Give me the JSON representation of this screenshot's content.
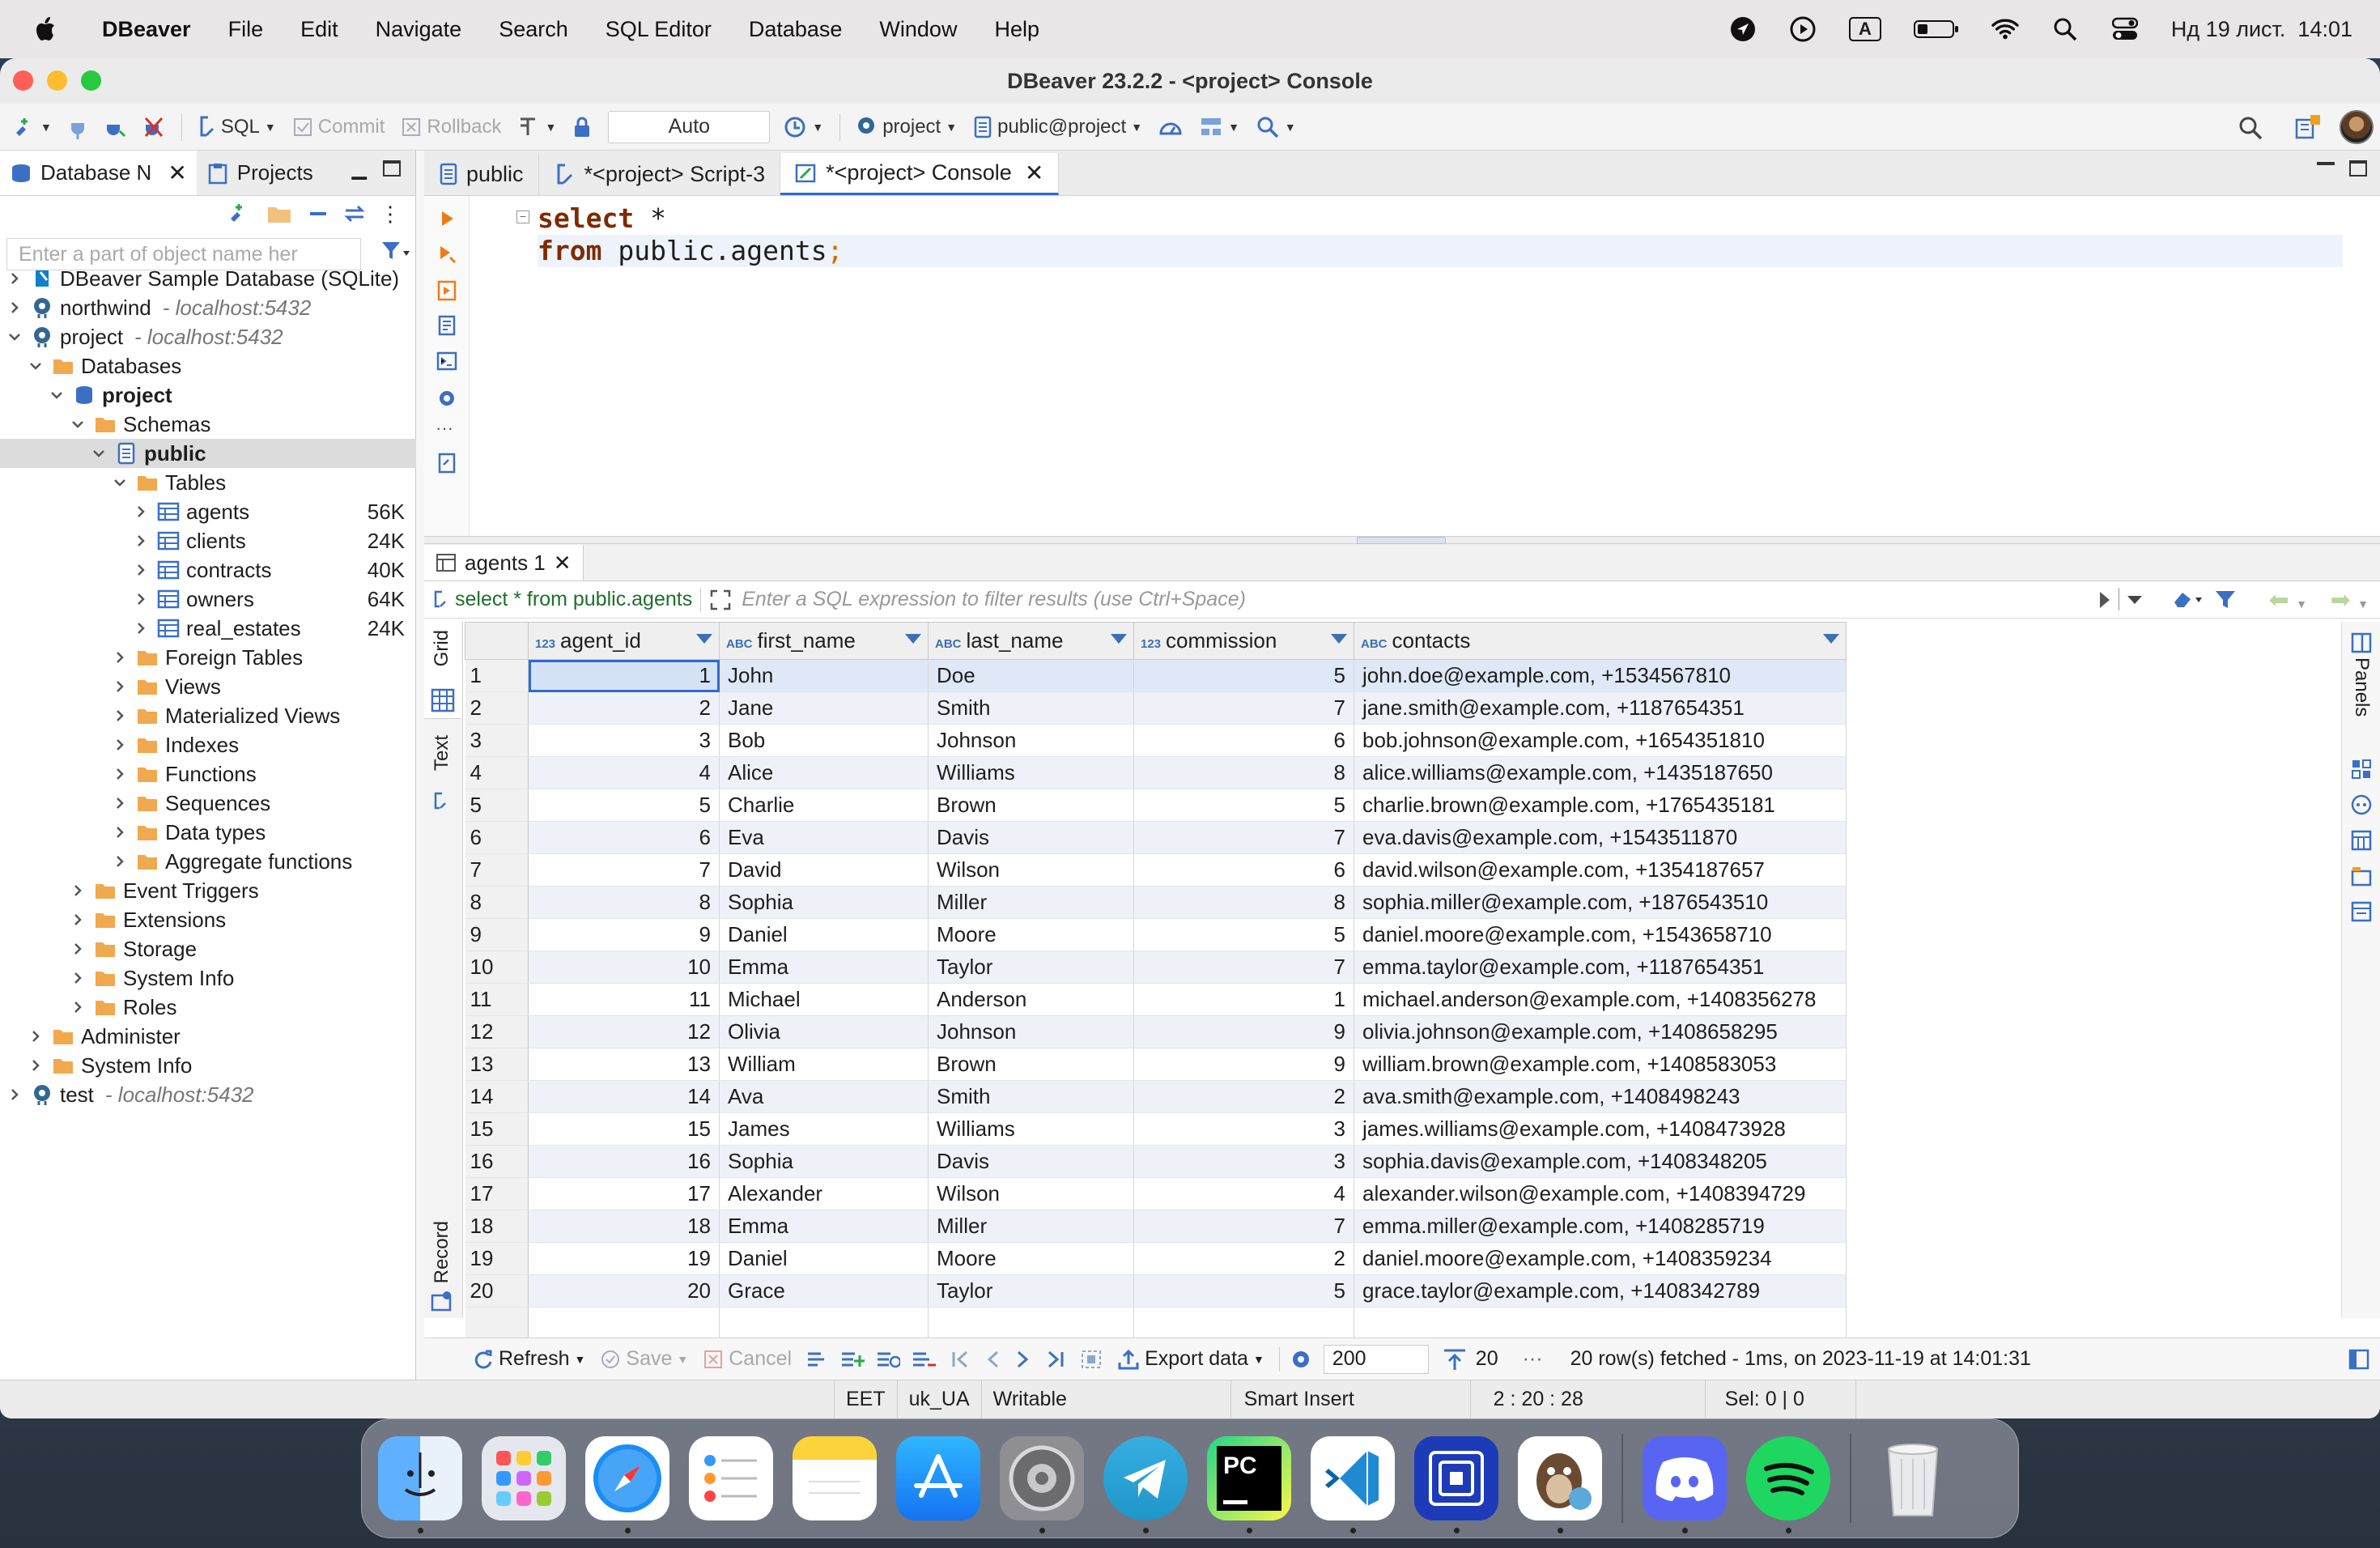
{
  "menubar": {
    "app": "DBeaver",
    "items": [
      "File",
      "Edit",
      "Navigate",
      "Search",
      "SQL Editor",
      "Database",
      "Window",
      "Help"
    ],
    "keyboard": "A",
    "datetime": "Нд 19 лист.  14:01"
  },
  "window": {
    "title": "DBeaver 23.2.2 - <project> Console"
  },
  "toolbar": {
    "sql": "SQL",
    "commit": "Commit",
    "rollback": "Rollback",
    "mode": "Auto",
    "datasource": "project",
    "schema": "public@project"
  },
  "navigator": {
    "tab_db": "Database N",
    "tab_projects": "Projects",
    "filter_placeholder": "Enter a part of object name her",
    "tree": [
      {
        "label": "DBeaver Sample Database (SQLite)",
        "host": "",
        "size": "",
        "indent": 0,
        "tw": ">",
        "icon": "sqlite"
      },
      {
        "label": "northwind",
        "host": "- localhost:5432",
        "size": "",
        "indent": 0,
        "tw": ">",
        "icon": "pg"
      },
      {
        "label": "project",
        "host": "- localhost:5432",
        "size": "",
        "indent": 0,
        "tw": "v",
        "icon": "pg"
      },
      {
        "label": "Databases",
        "host": "",
        "size": "",
        "indent": 1,
        "tw": "v",
        "icon": "folder"
      },
      {
        "label": "project",
        "host": "",
        "size": "",
        "indent": 2,
        "tw": "v",
        "icon": "db",
        "bold": true
      },
      {
        "label": "Schemas",
        "host": "",
        "size": "",
        "indent": 3,
        "tw": "v",
        "icon": "folder"
      },
      {
        "label": "public",
        "host": "",
        "size": "",
        "indent": 4,
        "tw": "v",
        "icon": "schema",
        "bold": true,
        "sel": true
      },
      {
        "label": "Tables",
        "host": "",
        "size": "",
        "indent": 5,
        "tw": "v",
        "icon": "folder"
      },
      {
        "label": "agents",
        "host": "",
        "size": "56K",
        "indent": 6,
        "tw": ">",
        "icon": "table"
      },
      {
        "label": "clients",
        "host": "",
        "size": "24K",
        "indent": 6,
        "tw": ">",
        "icon": "table"
      },
      {
        "label": "contracts",
        "host": "",
        "size": "40K",
        "indent": 6,
        "tw": ">",
        "icon": "table"
      },
      {
        "label": "owners",
        "host": "",
        "size": "64K",
        "indent": 6,
        "tw": ">",
        "icon": "table"
      },
      {
        "label": "real_estates",
        "host": "",
        "size": "24K",
        "indent": 6,
        "tw": ">",
        "icon": "table"
      },
      {
        "label": "Foreign Tables",
        "host": "",
        "size": "",
        "indent": 5,
        "tw": ">",
        "icon": "folder"
      },
      {
        "label": "Views",
        "host": "",
        "size": "",
        "indent": 5,
        "tw": ">",
        "icon": "folder"
      },
      {
        "label": "Materialized Views",
        "host": "",
        "size": "",
        "indent": 5,
        "tw": ">",
        "icon": "folder"
      },
      {
        "label": "Indexes",
        "host": "",
        "size": "",
        "indent": 5,
        "tw": ">",
        "icon": "folder"
      },
      {
        "label": "Functions",
        "host": "",
        "size": "",
        "indent": 5,
        "tw": ">",
        "icon": "folder"
      },
      {
        "label": "Sequences",
        "host": "",
        "size": "",
        "indent": 5,
        "tw": ">",
        "icon": "folder"
      },
      {
        "label": "Data types",
        "host": "",
        "size": "",
        "indent": 5,
        "tw": ">",
        "icon": "folder"
      },
      {
        "label": "Aggregate functions",
        "host": "",
        "size": "",
        "indent": 5,
        "tw": ">",
        "icon": "folder"
      },
      {
        "label": "Event Triggers",
        "host": "",
        "size": "",
        "indent": 3,
        "tw": ">",
        "icon": "folder"
      },
      {
        "label": "Extensions",
        "host": "",
        "size": "",
        "indent": 3,
        "tw": ">",
        "icon": "folder"
      },
      {
        "label": "Storage",
        "host": "",
        "size": "",
        "indent": 3,
        "tw": ">",
        "icon": "folder"
      },
      {
        "label": "System Info",
        "host": "",
        "size": "",
        "indent": 3,
        "tw": ">",
        "icon": "folder"
      },
      {
        "label": "Roles",
        "host": "",
        "size": "",
        "indent": 3,
        "tw": ">",
        "icon": "folder"
      },
      {
        "label": "Administer",
        "host": "",
        "size": "",
        "indent": 1,
        "tw": ">",
        "icon": "folder"
      },
      {
        "label": "System Info",
        "host": "",
        "size": "",
        "indent": 1,
        "tw": ">",
        "icon": "folder"
      },
      {
        "label": "test",
        "host": "- localhost:5432",
        "size": "",
        "indent": 0,
        "tw": ">",
        "icon": "pg"
      }
    ]
  },
  "editor": {
    "tabs": [
      "public",
      "*<project> Script-3",
      "*<project> Console"
    ],
    "sql_line1_kw": "select",
    "sql_line1_rest": " *",
    "sql_line2_kw": "from",
    "sql_line2_rest": " public.agents",
    "sql_line2_semi": ";"
  },
  "results": {
    "tab": "agents 1",
    "query": "select * from public.agents",
    "filter_placeholder": "Enter a SQL expression to filter results (use Ctrl+Space)",
    "side_tabs": [
      "Grid",
      "Text",
      "Record"
    ],
    "panels_label": "Panels",
    "columns": [
      {
        "type": "123",
        "name": "agent_id"
      },
      {
        "type": "ABC",
        "name": "first_name"
      },
      {
        "type": "ABC",
        "name": "last_name"
      },
      {
        "type": "123",
        "name": "commission"
      },
      {
        "type": "ABC",
        "name": "contacts"
      }
    ],
    "rows": [
      [
        "1",
        "1",
        "John",
        "Doe",
        "5",
        "john.doe@example.com, +1534567810"
      ],
      [
        "2",
        "2",
        "Jane",
        "Smith",
        "7",
        "jane.smith@example.com, +1187654351"
      ],
      [
        "3",
        "3",
        "Bob",
        "Johnson",
        "6",
        "bob.johnson@example.com, +1654351810"
      ],
      [
        "4",
        "4",
        "Alice",
        "Williams",
        "8",
        "alice.williams@example.com, +1435187650"
      ],
      [
        "5",
        "5",
        "Charlie",
        "Brown",
        "5",
        "charlie.brown@example.com, +1765435181"
      ],
      [
        "6",
        "6",
        "Eva",
        "Davis",
        "7",
        "eva.davis@example.com, +1543511870"
      ],
      [
        "7",
        "7",
        "David",
        "Wilson",
        "6",
        "david.wilson@example.com, +1354187657"
      ],
      [
        "8",
        "8",
        "Sophia",
        "Miller",
        "8",
        "sophia.miller@example.com, +1876543510"
      ],
      [
        "9",
        "9",
        "Daniel",
        "Moore",
        "5",
        "daniel.moore@example.com, +1543658710"
      ],
      [
        "10",
        "10",
        "Emma",
        "Taylor",
        "7",
        "emma.taylor@example.com, +1187654351"
      ],
      [
        "11",
        "11",
        "Michael",
        "Anderson",
        "1",
        "michael.anderson@example.com, +1408356278"
      ],
      [
        "12",
        "12",
        "Olivia",
        "Johnson",
        "9",
        "olivia.johnson@example.com, +1408658295"
      ],
      [
        "13",
        "13",
        "William",
        "Brown",
        "9",
        "william.brown@example.com, +1408583053"
      ],
      [
        "14",
        "14",
        "Ava",
        "Smith",
        "2",
        "ava.smith@example.com, +1408498243"
      ],
      [
        "15",
        "15",
        "James",
        "Williams",
        "3",
        "james.williams@example.com, +1408473928"
      ],
      [
        "16",
        "16",
        "Sophia",
        "Davis",
        "3",
        "sophia.davis@example.com, +1408348205"
      ],
      [
        "17",
        "17",
        "Alexander",
        "Wilson",
        "4",
        "alexander.wilson@example.com, +1408394729"
      ],
      [
        "18",
        "18",
        "Emma",
        "Miller",
        "7",
        "emma.miller@example.com, +1408285719"
      ],
      [
        "19",
        "19",
        "Daniel",
        "Moore",
        "2",
        "daniel.moore@example.com, +1408359234"
      ],
      [
        "20",
        "20",
        "Grace",
        "Taylor",
        "5",
        "grace.taylor@example.com, +1408342789"
      ]
    ],
    "bottom": {
      "refresh": "Refresh",
      "save": "Save",
      "cancel": "Cancel",
      "export": "Export data",
      "fetch_size": "200",
      "row_count": "20",
      "status": "20 row(s) fetched - 1ms, on 2023-11-19 at 14:01:31"
    }
  },
  "statusbar": {
    "timezone": "EET",
    "locale": "uk_UA",
    "mode": "Writable",
    "insert": "Smart Insert",
    "position": "2 : 20 : 28",
    "selection": "Sel: 0 | 0"
  },
  "dock": {
    "apps": [
      "finder",
      "launchpad",
      "safari",
      "reminders",
      "notes",
      "app-store",
      "system-settings",
      "telegram",
      "pycharm",
      "vscode",
      "dbeaver-alt",
      "dbeaver",
      "discord",
      "spotify",
      "trash"
    ]
  }
}
